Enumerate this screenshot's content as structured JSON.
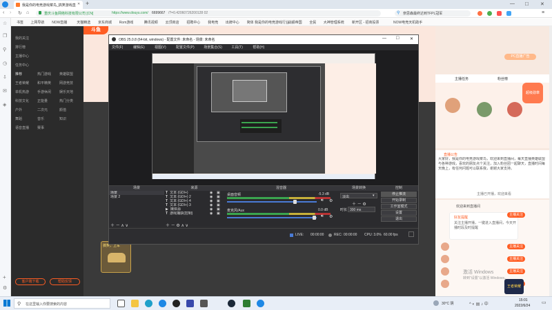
{
  "browser": {
    "tab_title": "我是你的电竞游戏菜鸟_搞笑游戏直播",
    "tab_add": "+",
    "site_identity": "重庆斗鱼网络科技有限公司 [CN]",
    "url_prefix": "https://www.douyu.com/",
    "url_path": "6699667",
    "url_suffix": "/?=0.42060726200128 02",
    "search_suggestion": "奈思森最终达到TFPL冠军",
    "window_min": "—",
    "window_max": "□",
    "window_close": "✕",
    "bookmarks": [
      "书签",
      "上网导航",
      "NOW直播",
      "天猫精选",
      "京东商城",
      "Rom游戏",
      "腾讯视频",
      "云顶商店",
      "招聘中心",
      "我电竞",
      "出牌中心",
      "简体 我是你的电竞游戏行业",
      "战舰帝国",
      "全民",
      "大神管理系统",
      "新开区 - 招商投票",
      "NOW电竞天机助手"
    ]
  },
  "douyu": {
    "logo": "斗鱼",
    "nav": [
      "我的关注",
      "排行榜",
      "主播中心",
      "任务中心",
      "推荐",
      "热门游戏",
      "英雄联盟",
      "王者荣耀",
      "和平精英",
      "网游竞技",
      "单机热游",
      "手游休闲",
      "娱乐天地",
      "科技文化",
      "正能量",
      "热门分类",
      "户外",
      "二次元",
      "颜值",
      "舞蹈",
      "音乐",
      "知识",
      "语音直播",
      "赛事"
    ],
    "nav_bottom_left": "客户端下载",
    "nav_bottom_right": "帮助反馈",
    "host_card_label": "搞笑，上车",
    "right_tabs": [
      "主播任务",
      "粉丝榜"
    ],
    "right_top_button": "PC直播广告",
    "badge_label": "超级勋章",
    "notice_title": "直播公告",
    "notice_text": "大家好，我是你的电竞游戏菜鸟，欢迎来到直播间，每天直播英雄联盟与各种游戏，喜欢的朋友点个关注，加入粉丝团一起聊天，直播时间每天晚上，有任何问题可以联系我，谢谢大家支持。",
    "notice_link": "主播已开播，欢迎来看",
    "chat_welcome": "欢迎来到直播间",
    "chat_popup_title": "好友提醒",
    "chat_popup_text": "关注主播开播，一键进入直播间，今天开播时段及时提醒",
    "chat_button": "主播关注",
    "chat_entries": [
      "主播关注",
      "主播关注",
      "主播关注",
      "主播关注"
    ],
    "watermark_title": "激活 Windows",
    "watermark_sub": "转到“设置”以激活 Windows。",
    "game_badge": "王者荣耀"
  },
  "obs": {
    "title": "OBS 25.0.8 (64-bit, windows) - 配置文件: 未命名 - 场景: 未命名",
    "menu": [
      "文件(F)",
      "编辑(E)",
      "视图(V)",
      "配置文件(P)",
      "场景集合(S)",
      "工具(T)",
      "帮助(H)"
    ],
    "docks": {
      "scenes": {
        "title": "场景",
        "items": [
          "场景",
          "场景 2"
        ]
      },
      "sources": {
        "title": "来源",
        "items": [
          "文本 (GDI+)",
          "文本 (GDI+) 2",
          "文本 (GDI+) 4",
          "文本 (GDI+) 3",
          "媒体源",
          "游戏捕获(控制)"
        ]
      },
      "mixer": {
        "title": "混音器",
        "channels": [
          {
            "name": "桌面音频",
            "db": "-5.3 dB"
          },
          {
            "name": "麦克风/Aux",
            "db": "0.0 dB"
          }
        ]
      },
      "transitions": {
        "title": "场景转换",
        "type": "淡出",
        "duration_label": "时长",
        "duration": "300 ms"
      },
      "controls": {
        "title": "控制",
        "buttons": [
          "停止推流",
          "开始录制",
          "工作室模式",
          "设置",
          "退出"
        ]
      }
    },
    "status": {
      "live_label": "LIVE:",
      "live_time": "00:00:00",
      "rec_label": "REC:",
      "rec_time": "00:00:00",
      "cpu": "CPU: 3.0%",
      "fps": "60.00 fps"
    }
  },
  "taskbar": {
    "search_placeholder": "在这里输入你要搜索的内容",
    "temperature": "30°C 阴",
    "time": "15:01",
    "date": "2022/6/24"
  },
  "colors": {
    "accent": "#ff5d23",
    "obs_bg": "#2d2d30",
    "nav_bg": "#2b2b2b"
  }
}
